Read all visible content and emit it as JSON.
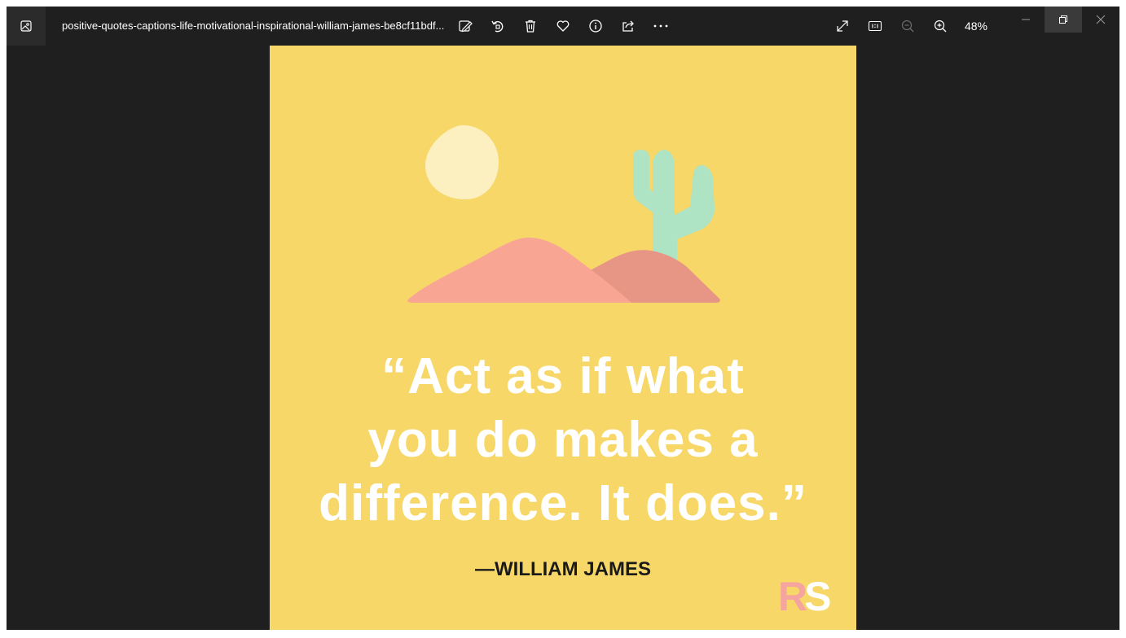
{
  "window": {
    "filename": "positive-quotes-captions-life-motivational-inspirational-william-james-be8cf11bdf...",
    "zoom": "48%"
  },
  "toolbar": {
    "actions": [
      {
        "name": "edit-image-icon"
      },
      {
        "name": "rotate-icon"
      },
      {
        "name": "delete-icon"
      },
      {
        "name": "favorite-heart-icon"
      },
      {
        "name": "info-icon"
      },
      {
        "name": "share-icon"
      },
      {
        "name": "more-options-icon"
      }
    ],
    "view_controls": [
      "fullscreen-icon",
      "actual-size-icon",
      "zoom-out-icon",
      "zoom-in-icon"
    ]
  },
  "image": {
    "quote_lines": [
      "“Act as if what",
      "you do makes a",
      "difference. It does.”"
    ],
    "author": "—WILLIAM JAMES",
    "logo_r": "R",
    "logo_s": "S",
    "colors": {
      "background": "#f7d768",
      "sun": "#fdf0c0",
      "cactus": "#aee3c4",
      "dune_front": "#f9a594",
      "dune_back": "#e79585"
    }
  }
}
